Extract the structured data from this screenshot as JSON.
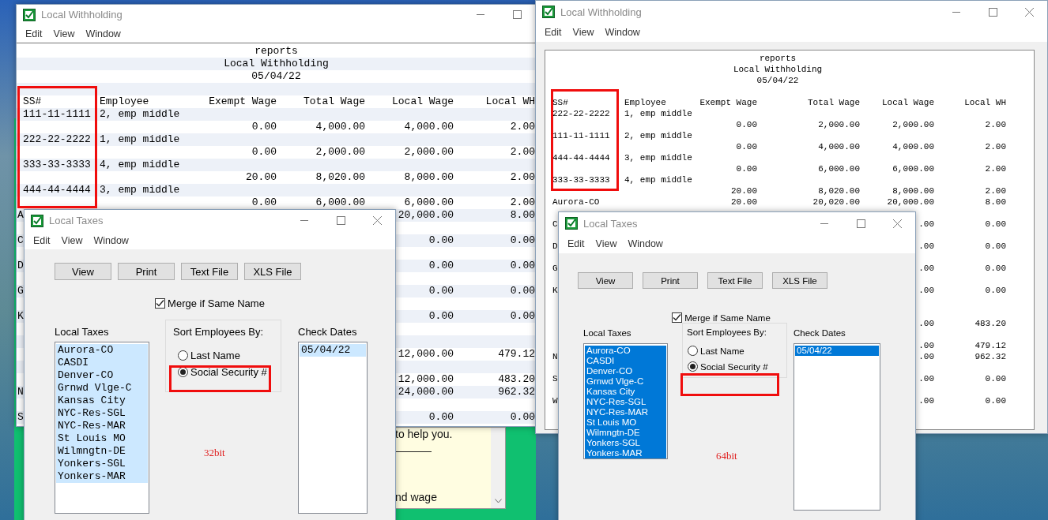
{
  "report_windows": [
    {
      "kind": "classic",
      "title": "Local Withholding",
      "menu": [
        "Edit",
        "View",
        "Window"
      ],
      "heading": [
        "reports",
        "Local Withholding",
        "05/04/22"
      ],
      "columns": [
        "SS#",
        "Employee",
        "Exempt Wage",
        "Total Wage",
        "Local Wage",
        "Local WH"
      ],
      "rows": [
        {
          "kind": "employee",
          "ss": "111-11-1111",
          "name": "2, emp middle"
        },
        {
          "kind": "amounts",
          "exempt": "0.00",
          "total": "4,000.00",
          "local": "4,000.00",
          "wh": "2.00"
        },
        {
          "kind": "employee",
          "ss": "222-22-2222",
          "name": "1, emp middle"
        },
        {
          "kind": "amounts",
          "exempt": "0.00",
          "total": "2,000.00",
          "local": "2,000.00",
          "wh": "2.00"
        },
        {
          "kind": "employee",
          "ss": "333-33-3333",
          "name": "4, emp middle"
        },
        {
          "kind": "amounts",
          "exempt": "20.00",
          "total": "8,020.00",
          "local": "8,000.00",
          "wh": "2.00"
        },
        {
          "kind": "employee",
          "ss": "444-44-4444",
          "name": "3, emp middle"
        },
        {
          "kind": "amounts",
          "exempt": "0.00",
          "total": "6,000.00",
          "local": "6,000.00",
          "wh": "2.00"
        },
        {
          "kind": "total",
          "label": "A",
          "local": "20,000.00",
          "wh": "8.00"
        },
        {
          "kind": "blank"
        },
        {
          "kind": "total",
          "label": "C",
          "local": "0.00",
          "wh": "0.00"
        },
        {
          "kind": "blank"
        },
        {
          "kind": "total",
          "label": "D",
          "local": "0.00",
          "wh": "0.00"
        },
        {
          "kind": "blank"
        },
        {
          "kind": "total",
          "label": "G",
          "local": "0.00",
          "wh": "0.00"
        },
        {
          "kind": "blank"
        },
        {
          "kind": "total",
          "label": "K",
          "local": "0.00",
          "wh": "0.00"
        },
        {
          "kind": "blank"
        },
        {
          "kind": "blank"
        },
        {
          "kind": "total",
          "local": "12,000.00",
          "wh": "479.12"
        },
        {
          "kind": "blank"
        },
        {
          "kind": "total",
          "local": "12,000.00",
          "wh": "483.20"
        },
        {
          "kind": "total",
          "label": "N",
          "local": "24,000.00",
          "wh": "962.32"
        },
        {
          "kind": "blank"
        },
        {
          "kind": "total",
          "label": "S",
          "local": "0.00",
          "wh": "0.00"
        }
      ]
    },
    {
      "kind": "modern",
      "title": "Local Withholding",
      "menu": [
        "Edit",
        "View",
        "Window"
      ],
      "heading": [
        "reports",
        "Local Withholding",
        "05/04/22"
      ],
      "columns": [
        "SS#",
        "Employee",
        "Exempt Wage",
        "Total Wage",
        "Local Wage",
        "Local WH"
      ],
      "rows": [
        {
          "kind": "employee",
          "ss": "222-22-2222",
          "name": "1, emp middle"
        },
        {
          "kind": "amounts",
          "exempt": "0.00",
          "total": "2,000.00",
          "local": "2,000.00",
          "wh": "2.00"
        },
        {
          "kind": "employee",
          "ss": "111-11-1111",
          "name": "2, emp middle"
        },
        {
          "kind": "amounts",
          "exempt": "0.00",
          "total": "4,000.00",
          "local": "4,000.00",
          "wh": "2.00"
        },
        {
          "kind": "employee",
          "ss": "444-44-4444",
          "name": "3, emp middle"
        },
        {
          "kind": "amounts",
          "exempt": "0.00",
          "total": "6,000.00",
          "local": "6,000.00",
          "wh": "2.00"
        },
        {
          "kind": "employee",
          "ss": "333-33-3333",
          "name": "4, emp middle"
        },
        {
          "kind": "amounts",
          "exempt": "20.00",
          "total": "8,020.00",
          "local": "8,000.00",
          "wh": "2.00"
        },
        {
          "kind": "total",
          "label": "Aurora-CO",
          "exempt": "20.00",
          "total": "20,020.00",
          "local": "20,000.00",
          "wh": "8.00"
        },
        {
          "kind": "blank"
        },
        {
          "kind": "total",
          "label": "C",
          "local": ".00",
          "wh": "0.00"
        },
        {
          "kind": "blank"
        },
        {
          "kind": "total",
          "label": "D",
          "local": ".00",
          "wh": "0.00"
        },
        {
          "kind": "blank"
        },
        {
          "kind": "total",
          "label": "G",
          "local": ".00",
          "wh": "0.00"
        },
        {
          "kind": "blank"
        },
        {
          "kind": "total",
          "label": "K",
          "local": ".00",
          "wh": "0.00"
        },
        {
          "kind": "blank"
        },
        {
          "kind": "blank"
        },
        {
          "kind": "total",
          "local": ".00",
          "wh": "483.20"
        },
        {
          "kind": "blank"
        },
        {
          "kind": "total",
          "local": ".00",
          "wh": "479.12"
        },
        {
          "kind": "total",
          "label": "N",
          "local": ".00",
          "wh": "962.32"
        },
        {
          "kind": "blank"
        },
        {
          "kind": "total",
          "label": "S",
          "local": ".00",
          "wh": "0.00"
        },
        {
          "kind": "blank"
        },
        {
          "kind": "total",
          "label": "W",
          "local": ".00",
          "wh": "0.00"
        }
      ]
    }
  ],
  "help_panel": {
    "lines": [
      "to help you.",
      "nd wage"
    ]
  },
  "tax_dialogs": [
    {
      "kind": "classic",
      "title": "Local Taxes",
      "menu": [
        "Edit",
        "View",
        "Window"
      ],
      "buttons": [
        "View",
        "Print",
        "Text File",
        "XLS File"
      ],
      "merge": {
        "label": "Merge if Same Name",
        "checked": true
      },
      "taxes": {
        "label": "Local Taxes",
        "items": [
          {
            "text": "Aurora-CO",
            "selected": true
          },
          {
            "text": "CASDI",
            "selected": true
          },
          {
            "text": "Denver-CO",
            "selected": true
          },
          {
            "text": "Grnwd Vlge-C",
            "selected": true
          },
          {
            "text": "Kansas City",
            "selected": true
          },
          {
            "text": "NYC-Res-SGL",
            "selected": true
          },
          {
            "text": "NYC-Res-MAR",
            "selected": true
          },
          {
            "text": "St Louis MO",
            "selected": true
          },
          {
            "text": "Wilmngtn-DE",
            "selected": true
          },
          {
            "text": "Yonkers-SGL",
            "selected": true
          },
          {
            "text": "Yonkers-MAR",
            "selected": true
          }
        ]
      },
      "sort": {
        "label": "Sort Employees By:",
        "options": [
          {
            "label": "Last Name",
            "selected": false
          },
          {
            "label": "Social Security #",
            "selected": true
          }
        ]
      },
      "dates": {
        "label": "Check Dates",
        "items": [
          {
            "text": "05/04/22",
            "selected": true
          }
        ]
      },
      "note": "32bit"
    },
    {
      "kind": "modern",
      "title": "Local Taxes",
      "menu": [
        "Edit",
        "View",
        "Window"
      ],
      "buttons": [
        "View",
        "Print",
        "Text File",
        "XLS File"
      ],
      "merge": {
        "label": "Merge if Same Name",
        "checked": true
      },
      "taxes": {
        "label": "Local Taxes",
        "items": [
          {
            "text": "Aurora-CO",
            "selected": true
          },
          {
            "text": "CASDI",
            "selected": true
          },
          {
            "text": "Denver-CO",
            "selected": true
          },
          {
            "text": "Grnwd Vlge-C",
            "selected": true
          },
          {
            "text": "Kansas City",
            "selected": true
          },
          {
            "text": "NYC-Res-SGL",
            "selected": true
          },
          {
            "text": "NYC-Res-MAR",
            "selected": true
          },
          {
            "text": "St Louis MO",
            "selected": true
          },
          {
            "text": "Wilmngtn-DE",
            "selected": true
          },
          {
            "text": "Yonkers-SGL",
            "selected": true
          },
          {
            "text": "Yonkers-MAR",
            "selected": true
          }
        ]
      },
      "sort": {
        "label": "Sort Employees By:",
        "options": [
          {
            "label": "Last Name",
            "selected": false
          },
          {
            "label": "Social Security #",
            "selected": true
          }
        ]
      },
      "dates": {
        "label": "Check Dates",
        "items": [
          {
            "text": "05/04/22",
            "selected": true
          }
        ]
      },
      "note": "64bit"
    }
  ]
}
